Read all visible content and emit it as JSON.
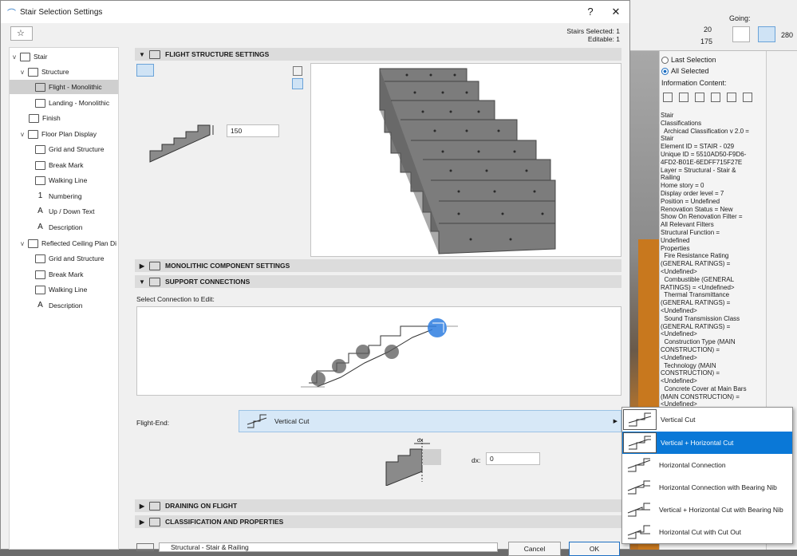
{
  "dialog": {
    "title": "Stair Selection Settings",
    "help": "?",
    "close": "✕",
    "stairs_selected": "Stairs Selected: 1",
    "editable": "Editable: 1"
  },
  "tree": {
    "items": [
      {
        "label": "Stair"
      },
      {
        "label": "Structure"
      },
      {
        "label": "Flight - Monolithic"
      },
      {
        "label": "Landing - Monolithic"
      },
      {
        "label": "Finish"
      },
      {
        "label": "Floor Plan Display"
      },
      {
        "label": "Grid and Structure"
      },
      {
        "label": "Break Mark"
      },
      {
        "label": "Walking Line"
      },
      {
        "label": "Numbering"
      },
      {
        "label": "Up / Down Text"
      },
      {
        "label": "Description"
      },
      {
        "label": "Reflected Ceiling Plan Di"
      },
      {
        "label": "Grid and Structure"
      },
      {
        "label": "Break Mark"
      },
      {
        "label": "Walking Line"
      },
      {
        "label": "Description"
      }
    ]
  },
  "sections": {
    "flight_structure": "FLIGHT STRUCTURE SETTINGS",
    "monolithic": "MONOLITHIC COMPONENT SETTINGS",
    "support": "SUPPORT CONNECTIONS",
    "draining": "DRAINING ON FLIGHT",
    "classification": "CLASSIFICATION AND PROPERTIES"
  },
  "flight": {
    "thickness_value": "150"
  },
  "support": {
    "select_label": "Select Connection to Edit:",
    "flight_end_label": "Flight-End:",
    "flight_end_value": "Vertical Cut",
    "dx_label": "dx:",
    "dx_value": "0",
    "dx_marker": "dx"
  },
  "menu": {
    "items": [
      {
        "label": "Vertical Cut"
      },
      {
        "label": "Vertical + Horizontal Cut"
      },
      {
        "label": "Horizontal Connection"
      },
      {
        "label": "Horizontal Connection with Bearing Nib"
      },
      {
        "label": "Vertical + Horizontal Cut with Bearing Nib"
      },
      {
        "label": "Horizontal Cut with Cut Out"
      }
    ]
  },
  "footer": {
    "layer": "Structural - Stair & Railing",
    "cancel": "Cancel",
    "ok": "OK"
  },
  "right_panel": {
    "going_label": "Going:",
    "val_20": "20",
    "val_175": "175",
    "val_280": "280",
    "last_selection": "Last Selection",
    "all_selected": "All Selected",
    "info_content": "Information Content:",
    "info_lines": [
      "Stair",
      "Classifications",
      "  Archicad Classification v 2.0 =",
      "Stair",
      "Element ID = STAIR - 029",
      "Unique ID = 5510AD50-F9D6-",
      "4FD2-B01E-6EDFF715F27E",
      "Layer = Structural - Stair &",
      "Railing",
      "Home story = 0",
      "Display order level = 7",
      "Position = Undefined",
      "Renovation Status = New",
      "Show On Renovation Filter =",
      "All Relevant Filters",
      "Structural Function =",
      "Undefined",
      "Properties",
      "  Fire Resistance Rating",
      "(GENERAL RATINGS) =",
      "<Undefined>",
      "  Combustible (GENERAL",
      "RATINGS) = <Undefined>",
      "  Thermal Transmittance",
      "(GENERAL RATINGS) =",
      "<Undefined>",
      "  Sound Transmission Class",
      "(GENERAL RATINGS) =",
      "<Undefined>",
      "  Construction Type (MAIN",
      "CONSTRUCTION) =",
      "<Undefined>",
      "  Technology (MAIN",
      "CONSTRUCTION) =",
      "<Undefined>",
      "  Concrete Cover at Main Bars",
      "(MAIN CONSTRUCTION) =",
      "<Undefined>"
    ]
  }
}
